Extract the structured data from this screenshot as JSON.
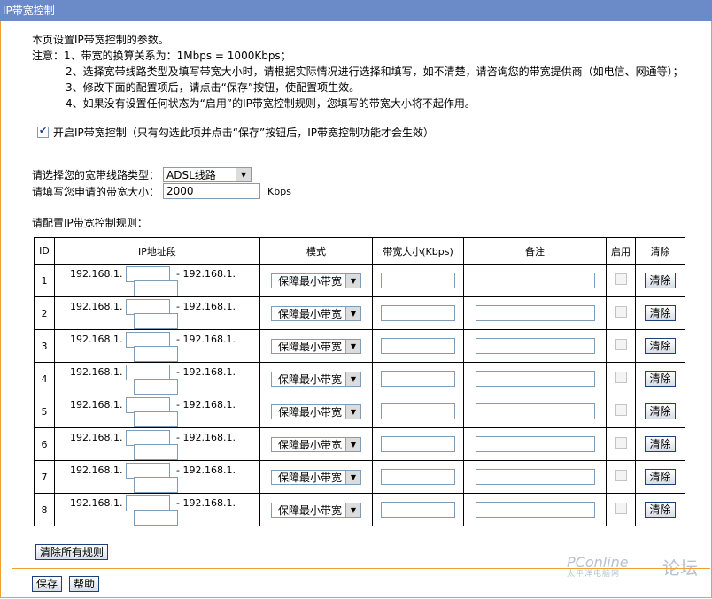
{
  "title": "IP带宽控制",
  "notes": {
    "intro": "本页设置IP带宽控制的参数。",
    "items": [
      "注意：1、带宽的换算关系为：1Mbps = 1000Kbps；",
      "2、选择宽带线路类型及填写带宽大小时，请根据实际情况进行选择和填写，如不清楚，请咨询您的带宽提供商（如电信、网通等）；",
      "3、修改下面的配置项后，请点击“保存”按钮，使配置项生效。",
      "4、如果没有设置任何状态为“启用”的IP带宽控制规则，您填写的带宽大小将不起作用。"
    ]
  },
  "enable": {
    "checked": true,
    "label": "开启IP带宽控制（只有勾选此项并点击“保存”按钮后，IP带宽控制功能才会生效）"
  },
  "line_type": {
    "label": "请选择您的宽带线路类型：",
    "value": "ADSL线路"
  },
  "bandwidth": {
    "label": "请填写您申请的带宽大小：",
    "value": "2000",
    "unit": "Kbps"
  },
  "section_label": "请配置IP带宽控制规则：",
  "table": {
    "headers": {
      "id": "ID",
      "ip": "IP地址段",
      "mode": "模式",
      "bw": "带宽大小(Kbps)",
      "note": "备注",
      "enable": "启用",
      "clear": "清除"
    },
    "ip_prefix": "192.168.1.",
    "ip_sep": "- 192.168.1.",
    "mode_value": "保障最小带宽",
    "clear_label": "清除",
    "rows": [
      "1",
      "2",
      "3",
      "4",
      "5",
      "6",
      "7",
      "8"
    ]
  },
  "buttons": {
    "clear_all": "清除所有规则",
    "save": "保存",
    "help": "帮助"
  },
  "watermark": {
    "brand": "PConline",
    "sub": "太平洋电脑网",
    "forum": "论坛"
  },
  "colors": {
    "title_bg": "#6a8ac8",
    "border_accent": "#f0a030"
  }
}
